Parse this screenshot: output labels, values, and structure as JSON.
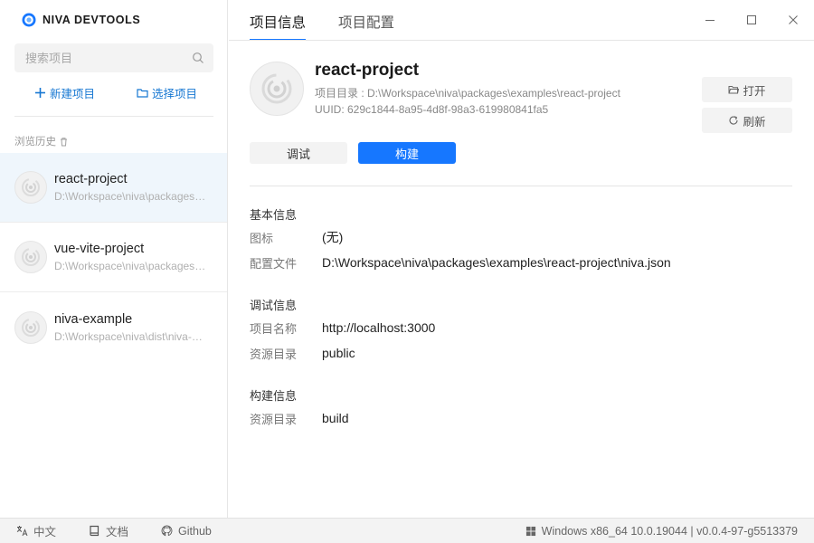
{
  "app": {
    "brand": "NIVA DEVTOOLS",
    "accent": "#1677ff"
  },
  "sidebar": {
    "search_placeholder": "搜索项目",
    "new_project": "新建项目",
    "select_project": "选择项目",
    "history_label": "浏览历史",
    "projects": [
      {
        "name": "react-project",
        "path": "D:\\Workspace\\niva\\packages\\examples\\react-project",
        "active": true
      },
      {
        "name": "vue-vite-project",
        "path": "D:\\Workspace\\niva\\packages\\examples\\vue-vite-project",
        "active": false
      },
      {
        "name": "niva-example",
        "path": "D:\\Workspace\\niva\\dist\\niva-example",
        "active": false
      }
    ]
  },
  "tabs": [
    {
      "label": "项目信息",
      "active": true
    },
    {
      "label": "项目配置",
      "active": false
    }
  ],
  "project": {
    "name": "react-project",
    "dir_line": "项目目录 : D:\\Workspace\\niva\\packages\\examples\\react-project",
    "uuid_line": "UUID: 629c1844-8a95-4d8f-98a3-619980841fa5",
    "open_label": "打开",
    "refresh_label": "刷新",
    "debug_label": "调试",
    "build_label": "构建"
  },
  "sections": [
    {
      "title": "基本信息",
      "rows": [
        {
          "key": "图标",
          "value": "(无)"
        },
        {
          "key": "配置文件",
          "value": "D:\\Workspace\\niva\\packages\\examples\\react-project\\niva.json"
        }
      ]
    },
    {
      "title": "调试信息",
      "rows": [
        {
          "key": "项目名称",
          "value": "http://localhost:3000"
        },
        {
          "key": "资源目录",
          "value": "public"
        }
      ]
    },
    {
      "title": "构建信息",
      "rows": [
        {
          "key": "资源目录",
          "value": "build"
        }
      ]
    }
  ],
  "statusbar": {
    "language": "中文",
    "docs": "文档",
    "github": "Github",
    "system": "Windows x86_64 10.0.19044 | v0.0.4-97-g5513379"
  }
}
